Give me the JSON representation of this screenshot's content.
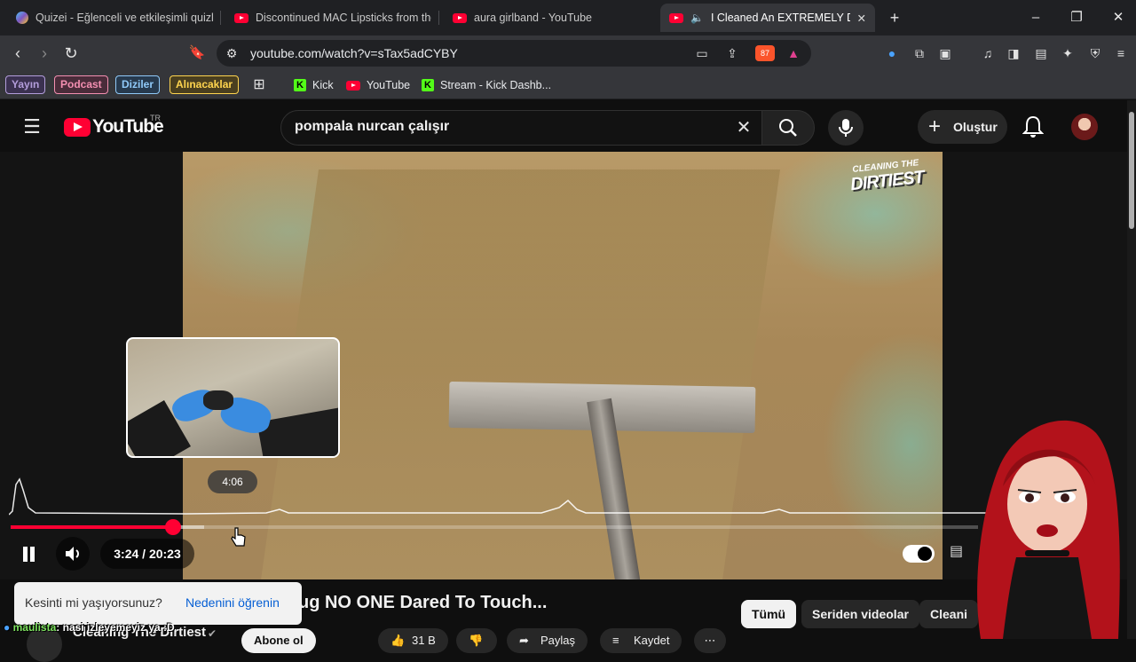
{
  "browser": {
    "tabs": [
      {
        "title": "Quizei - Eğlenceli ve etkileşimli quizle",
        "icon": "quiz-favicon"
      },
      {
        "title": "Discontinued MAC Lipsticks from the",
        "icon": "youtube-favicon"
      },
      {
        "title": "aura girlband - YouTube",
        "icon": "youtube-favicon"
      },
      {
        "title": "I Cleaned An EXTREMELY DIRT",
        "icon": "youtube-favicon",
        "active": true
      }
    ],
    "new_tab_label": "+",
    "window_controls": {
      "minimize": "–",
      "maximize": "❐",
      "close": "✕"
    },
    "url": "youtube.com/watch?v=sTax5adCYBY",
    "extension_badge": "87",
    "bookmark_chips": [
      {
        "label": "Yayın",
        "color": "#b39ddb"
      },
      {
        "label": "Podcast",
        "color": "#f48fb1"
      },
      {
        "label": "Diziler",
        "color": "#90caf9"
      },
      {
        "label": "Alınacaklar",
        "color": "#ffd54f"
      }
    ],
    "bookmark_links": [
      "Kick",
      "YouTube",
      "Stream - Kick Dashb..."
    ]
  },
  "youtube": {
    "wordmark": "YouTube",
    "country": "TR",
    "search_query": "pompala nurcan çalışır",
    "create_label": "Oluştur",
    "brand_color": "#ff0033"
  },
  "player": {
    "watermark_top": "CLEANING THE",
    "watermark_bottom": "DIRTIEST",
    "preview_time": "4:06",
    "current_time": "3:24 / 20:23",
    "progress_fraction": 0.168,
    "buffer_fraction": 0.2
  },
  "below": {
    "title": "ug NO ONE Dared To Touch...",
    "interrupt_question": "Kesinti mi yaşıyorsunuz?",
    "interrupt_link": "Nedenini öğrenin",
    "channel": "Cleaning The Dirtiest",
    "chips": [
      "Tümü",
      "Seriden videolar",
      "Cleani"
    ],
    "bottom_buttons": [
      "Abone ol",
      "31 B",
      "Paylaş",
      "Kaydet"
    ]
  },
  "chat": {
    "user": "maulista",
    "message": ": nasi izleyemeyiz ya :D"
  }
}
